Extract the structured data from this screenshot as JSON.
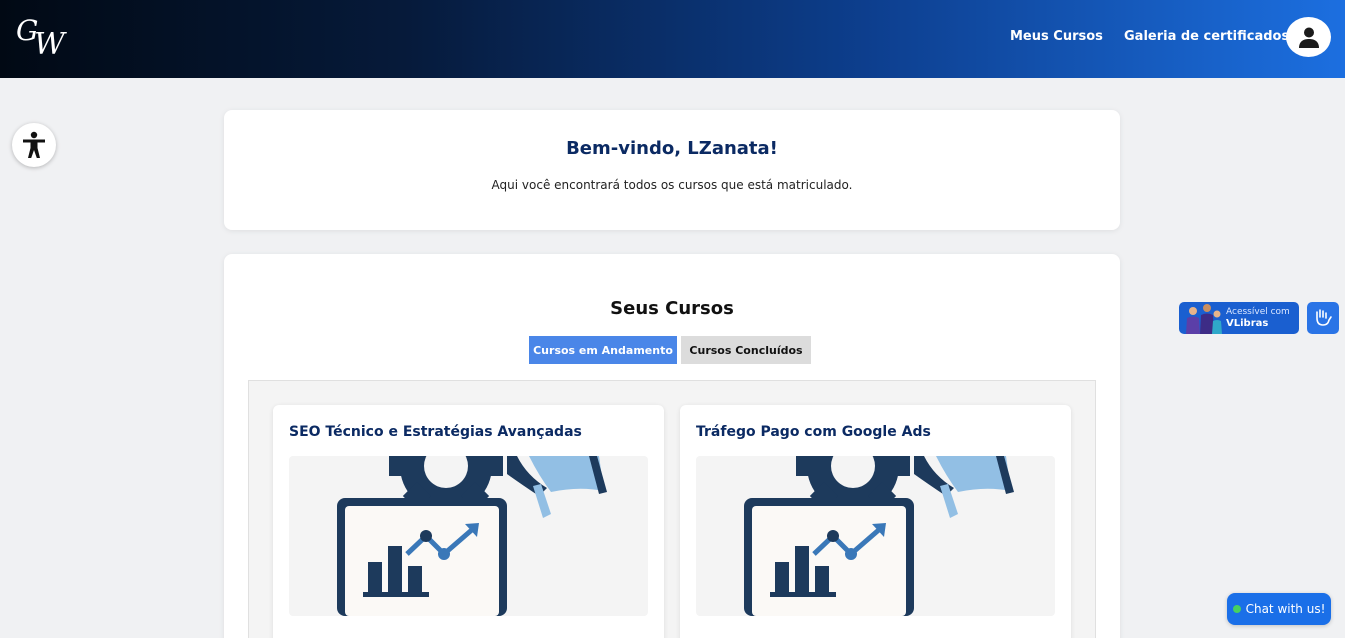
{
  "header": {
    "logo_text": "GW",
    "nav": {
      "my_courses": "Meus Cursos",
      "certificates_gallery": "Galeria de certificados"
    },
    "avatar_icon": "user-icon"
  },
  "accessibility": {
    "icon": "accessibility-icon"
  },
  "welcome": {
    "title": "Bem-vindo, LZanata!",
    "subtitle": "Aqui você encontrará todos os cursos que está matriculado."
  },
  "courses": {
    "heading": "Seus Cursos",
    "tabs": [
      {
        "label": "Cursos em Andamento",
        "active": true
      },
      {
        "label": "Cursos Concluídos",
        "active": false
      }
    ],
    "items": [
      {
        "title": "SEO Técnico e Estratégias Avançadas",
        "image_icon": "marketing-chart-icon"
      },
      {
        "title": "Tráfego Pago com Google Ads",
        "image_icon": "marketing-chart-icon"
      }
    ]
  },
  "vlibras": {
    "line1": "Acessível com",
    "line2": "VLibras",
    "hand_icon": "sign-language-icon"
  },
  "chat": {
    "label": "Chat with us!"
  },
  "colors": {
    "header_gradient_start": "#010914",
    "header_gradient_end": "#1c6fe0",
    "title_navy": "#0b2a63",
    "tab_active": "#4a86e8",
    "chat_blue": "#1a6fe8"
  }
}
